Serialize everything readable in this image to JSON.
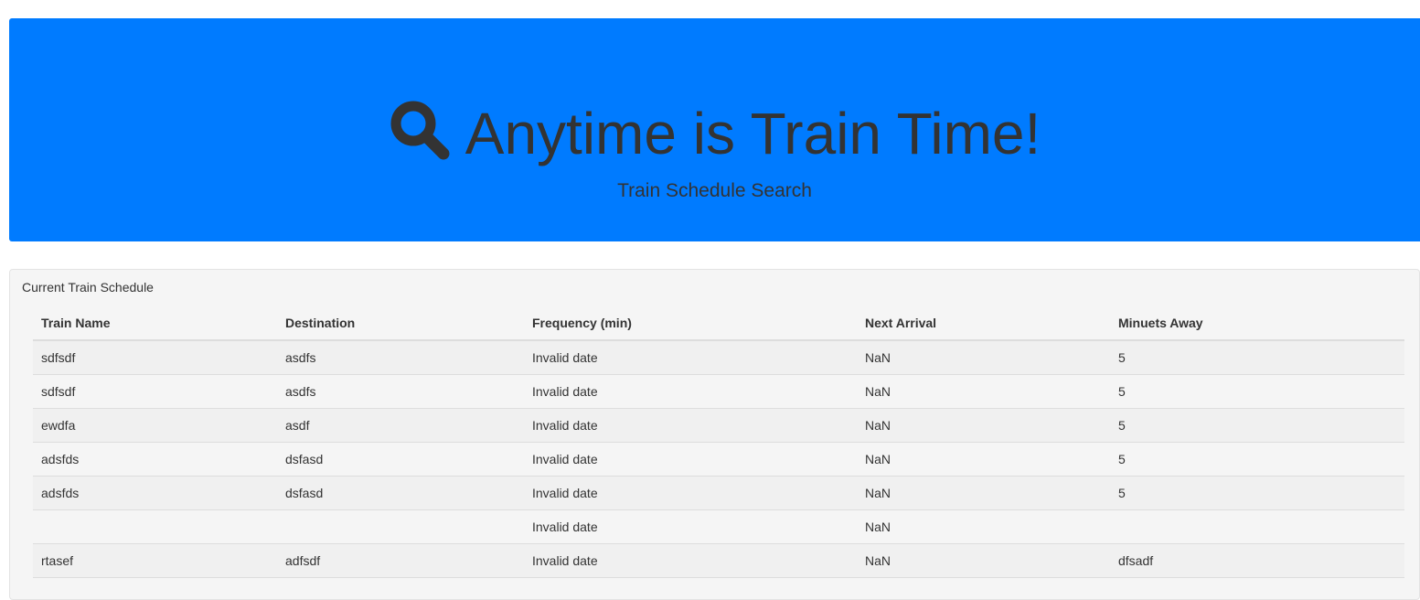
{
  "header": {
    "icon": "search-icon",
    "title": "Anytime is Train Time!",
    "subtitle": "Train Schedule Search",
    "background_color": "#007bff"
  },
  "schedule": {
    "panel_title": "Current Train Schedule",
    "columns": [
      "Train Name",
      "Destination",
      "Frequency (min)",
      "Next Arrival",
      "Minuets Away"
    ],
    "rows": [
      [
        "sdfsdf",
        "asdfs",
        "Invalid date",
        "NaN",
        "5"
      ],
      [
        "sdfsdf",
        "asdfs",
        "Invalid date",
        "NaN",
        "5"
      ],
      [
        "ewdfa",
        "asdf",
        "Invalid date",
        "NaN",
        "5"
      ],
      [
        "adsfds",
        "dsfasd",
        "Invalid date",
        "NaN",
        "5"
      ],
      [
        "adsfds",
        "dsfasd",
        "Invalid date",
        "NaN",
        "5"
      ],
      [
        "",
        "",
        "Invalid date",
        "NaN",
        ""
      ],
      [
        "rtasef",
        "adfsdf",
        "Invalid date",
        "NaN",
        "dfsadf"
      ]
    ]
  }
}
